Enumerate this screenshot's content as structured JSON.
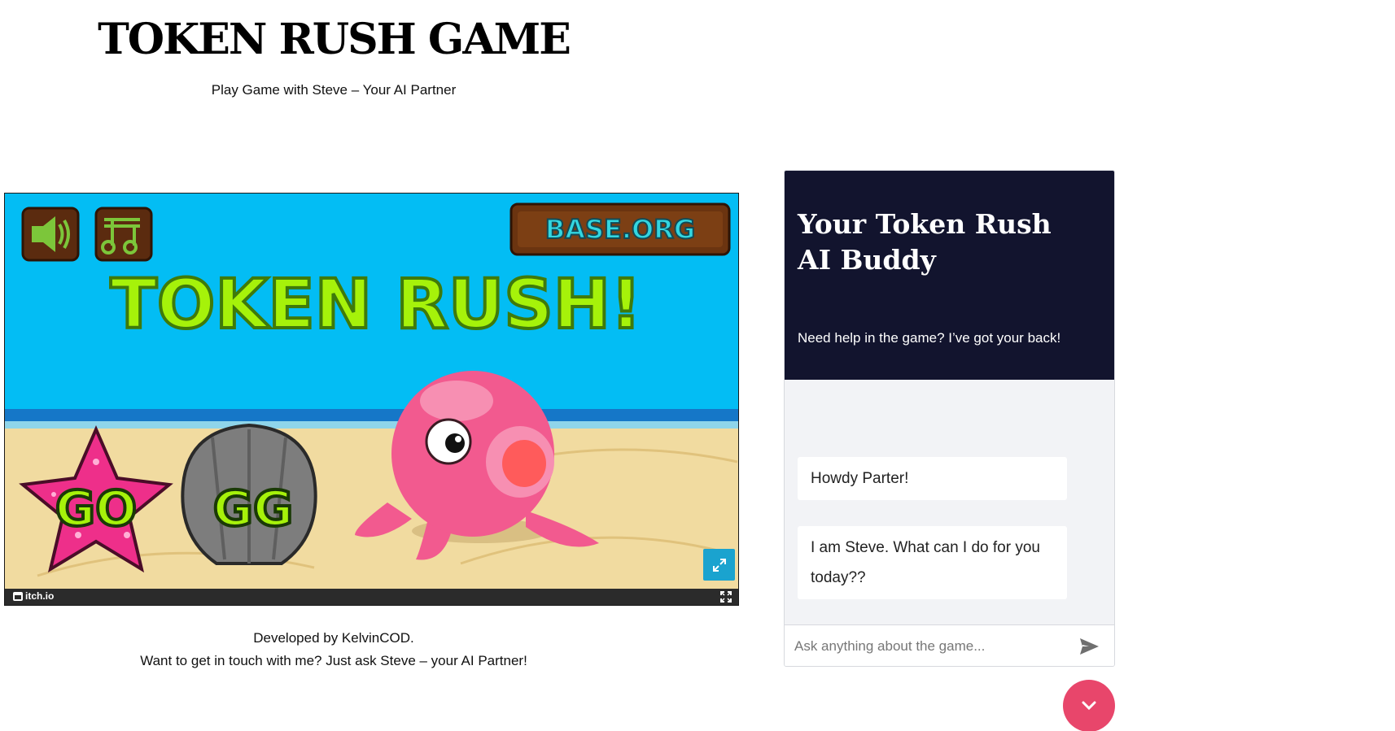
{
  "page": {
    "title": "TOKEN RUSH GAME",
    "subtitle": "Play Game with Steve – Your AI Partner"
  },
  "game": {
    "banner_label": "BASE.ORG",
    "logo_text": "TOKEN RUSH!",
    "go_label": "GO",
    "gg_label": "GG",
    "platform_label": "itch.io",
    "icons": [
      "speaker-icon",
      "music-note-icon",
      "expand-icon",
      "fullscreen-icon"
    ],
    "colors": {
      "sky": "#03bdf4",
      "logo_green": "#a6f20a",
      "sand": "#f1dba0",
      "octopus": "#f25a8f"
    }
  },
  "footer": {
    "line1": "Developed by KelvinCOD.",
    "line2": "Want to get in touch with me? Just ask Steve – your AI Partner!"
  },
  "chat": {
    "title": "Your Token Rush AI Buddy",
    "subtitle": "Need help in the game? I’ve got your back!",
    "messages": [
      {
        "text": "Howdy Parter!"
      },
      {
        "text": "I am Steve. What can I do for you today??"
      }
    ],
    "input_placeholder": "Ask anything about the game...",
    "input_value": "",
    "colors": {
      "header_bg": "#12142e",
      "collapse_button": "#e8466b"
    }
  }
}
